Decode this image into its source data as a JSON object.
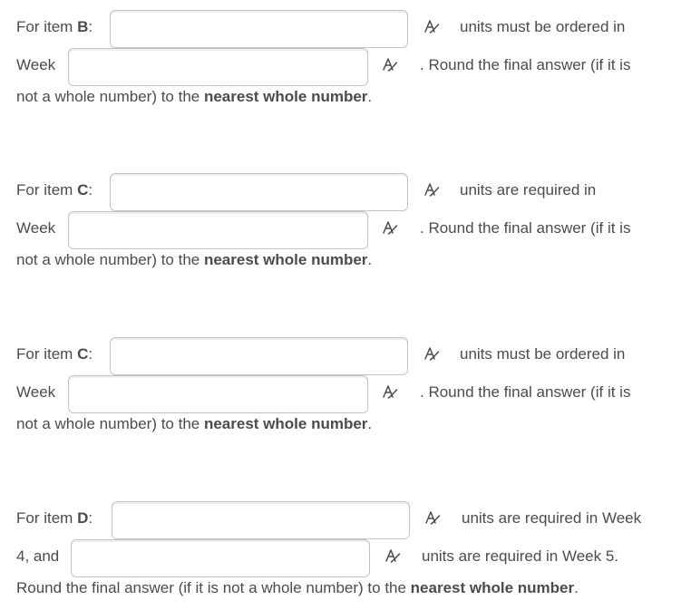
{
  "blocks": [
    {
      "item_prefix": "For item ",
      "item_letter": "B",
      "item_suffix": ":",
      "after_first_input": "units must be ordered in",
      "week_prefix": "Week",
      "after_second_input": ". Round the final answer (if it is",
      "last_line_plain": "not a whole number) to the ",
      "last_line_bold": "nearest whole number",
      "last_line_end": "."
    },
    {
      "item_prefix": "For item ",
      "item_letter": "C",
      "item_suffix": ":",
      "after_first_input": "units are required in",
      "week_prefix": "Week",
      "after_second_input": ". Round the final answer (if it is",
      "last_line_plain": "not a whole number) to the ",
      "last_line_bold": "nearest whole number",
      "last_line_end": "."
    },
    {
      "item_prefix": "For item ",
      "item_letter": "C",
      "item_suffix": ":",
      "after_first_input": "units must be ordered in",
      "week_prefix": "Week",
      "after_second_input": ". Round the final answer (if it is",
      "last_line_plain": "not a whole number) to the ",
      "last_line_bold": "nearest whole number",
      "last_line_end": "."
    },
    {
      "item_prefix": "For item ",
      "item_letter": "D",
      "item_suffix": ":",
      "after_first_input": "units are required in Week",
      "week_prefix": "4, and",
      "after_second_input": "units are required in Week 5.",
      "last_line_plain": "Round the final answer (if it is not a whole number) to the ",
      "last_line_bold": "nearest whole number",
      "last_line_end": "."
    }
  ],
  "inputs": [
    {
      "value": ""
    },
    {
      "value": ""
    },
    {
      "value": ""
    },
    {
      "value": ""
    },
    {
      "value": ""
    },
    {
      "value": ""
    },
    {
      "value": ""
    },
    {
      "value": ""
    }
  ],
  "icons": {
    "math_editor": "math-editor-icon"
  },
  "colors": {
    "text": "#494c4e",
    "input_border": "#c1c4c7",
    "icon": "#494c4e"
  }
}
